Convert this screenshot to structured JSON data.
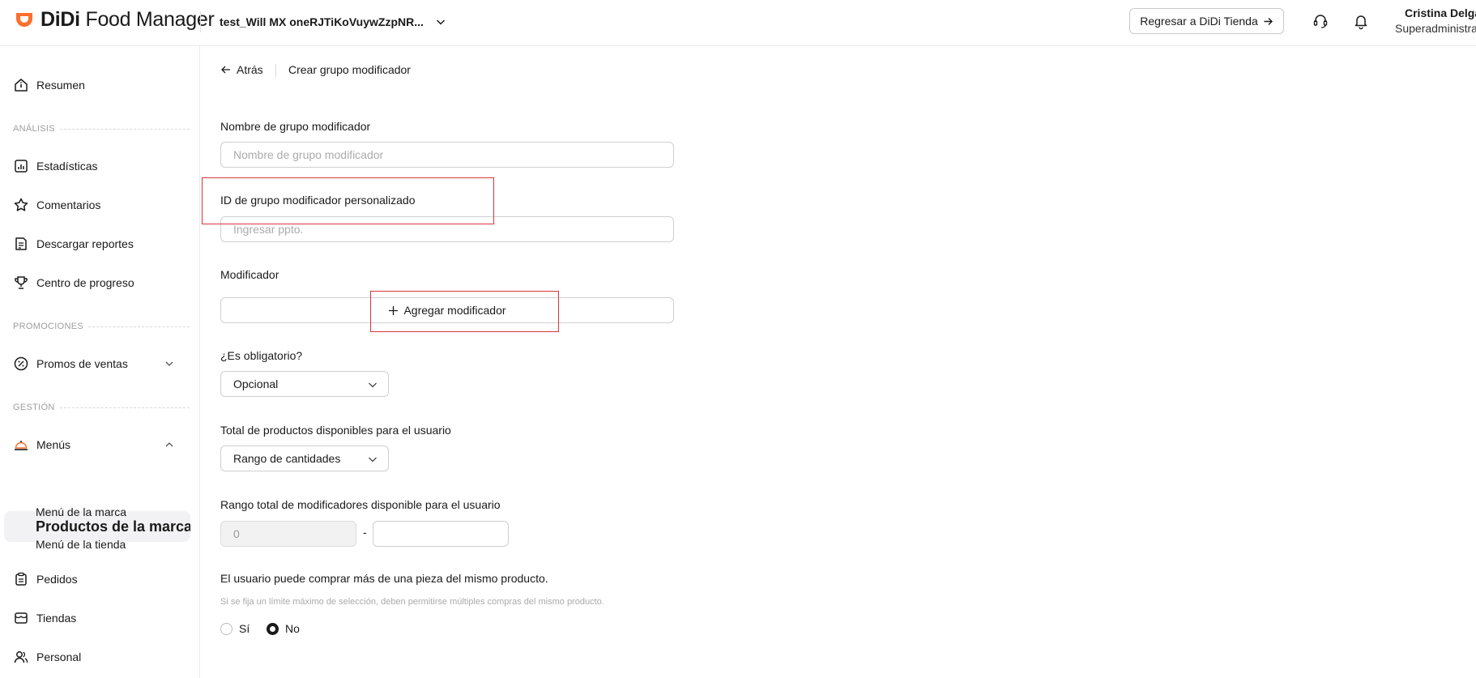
{
  "header": {
    "logo_brand": "DiDi",
    "logo_product": "Food Manager",
    "store_name": "test_Will MX oneRJTiKoVuywZzpNR...",
    "back_to_store_label": "Regresar a DiDi Tienda",
    "user_name": "Cristina Delgado",
    "user_role": "Superadministrador"
  },
  "sidebar": {
    "summary": "Resumen",
    "section_analysis": "ANÁLISIS",
    "statistics": "Estadísticas",
    "comments": "Comentarios",
    "download_reports": "Descargar reportes",
    "progress_center": "Centro de progreso",
    "section_promotions": "PROMOCIONES",
    "sales_promos": "Promos de ventas",
    "section_management": "GESTIÓN",
    "menus": "Menús",
    "brand_products": "Productos de la marca",
    "brand_menu": "Menú de la marca",
    "store_menu": "Menú de la tienda",
    "orders": "Pedidos",
    "stores": "Tiendas",
    "staff": "Personal"
  },
  "breadcrumb": {
    "back_label": "Atrás",
    "title": "Crear grupo modificador"
  },
  "form": {
    "group_name_label": "Nombre de grupo modificador",
    "group_name_placeholder": "Nombre de grupo modificador",
    "custom_id_label": "ID de grupo modificador personalizado",
    "custom_id_placeholder": "Ingresar ppto.",
    "modifier_label": "Modificador",
    "add_modifier_label": "Agregar modificador",
    "required_label": "¿Es obligatorio?",
    "required_value": "Opcional",
    "total_products_label": "Total de productos disponibles para el usuario",
    "total_products_value": "Rango de cantidades",
    "range_label": "Rango total de modificadores disponible para el usuario",
    "range_min": "0",
    "range_separator": "-",
    "range_max": "",
    "multi_buy_label": "El usuario puede comprar más de una pieza del mismo producto.",
    "multi_buy_helper": "Si se fija un límite máximo de selección, deben permitirse múltiples compras del mismo producto.",
    "option_yes": "Sí",
    "option_no": "No",
    "selected_option": "No"
  },
  "colors": {
    "brand_orange": "#fc6e2b",
    "highlight_red": "#d9363e",
    "active_nav_bg": "#f2f2f4"
  }
}
